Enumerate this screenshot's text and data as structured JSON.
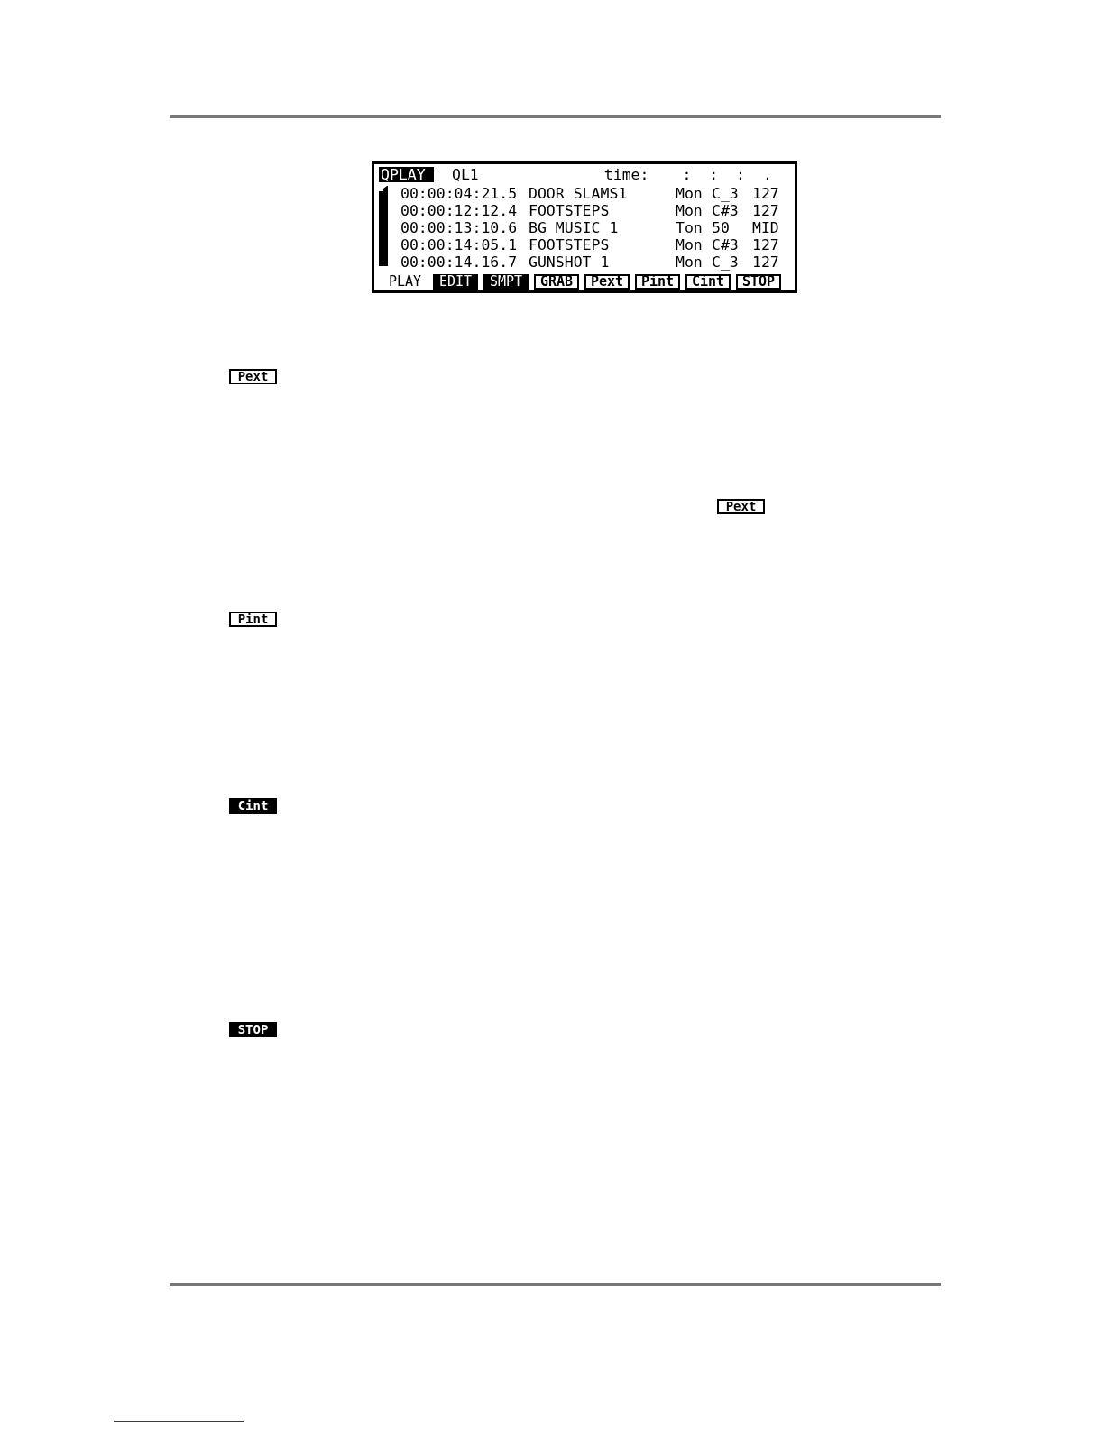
{
  "display": {
    "mode": "QPLAY",
    "list": "QL1",
    "time_label": "time:",
    "time_value": ":  :  :  .",
    "events": [
      {
        "timecode": "00:00:04:21.5",
        "name": "DOOR SLAMS1",
        "column_3": "Mon",
        "column_4": "C_3",
        "column_5": "127"
      },
      {
        "timecode": "00:00:12:12.4",
        "name": "FOOTSTEPS",
        "column_3": "Mon",
        "column_4": "C#3",
        "column_5": "127"
      },
      {
        "timecode": "00:00:13:10.6",
        "name": "BG MUSIC 1",
        "column_3": "Ton",
        "column_4": "50",
        "column_5": "MID"
      },
      {
        "timecode": "00:00:14:05.1",
        "name": "FOOTSTEPS",
        "column_3": "Mon",
        "column_4": "C#3",
        "column_5": "127"
      },
      {
        "timecode": "00:00:14.16.7",
        "name": "GUNSHOT 1",
        "column_3": "Mon",
        "column_4": "C_3",
        "column_5": "127"
      }
    ],
    "soft_keys": [
      {
        "label": "PLAY",
        "kind": "plain"
      },
      {
        "label": "EDIT",
        "kind": "inverted"
      },
      {
        "label": "SMPT",
        "kind": "inverted"
      },
      {
        "label": "GRAB",
        "kind": "outlined"
      },
      {
        "label": "Pext",
        "kind": "outlined"
      },
      {
        "label": "Pint",
        "kind": "outlined"
      },
      {
        "label": "Cint",
        "kind": "outlined"
      },
      {
        "label": "STOP",
        "kind": "outlined"
      }
    ]
  },
  "page_keys": [
    {
      "label": "Pext",
      "kind": "outlined"
    },
    {
      "label": "Pext",
      "kind": "outlined"
    },
    {
      "label": "Pint",
      "kind": "outlined"
    },
    {
      "label": "Cint",
      "kind": "inverted"
    },
    {
      "label": "STOP",
      "kind": "inverted"
    }
  ]
}
